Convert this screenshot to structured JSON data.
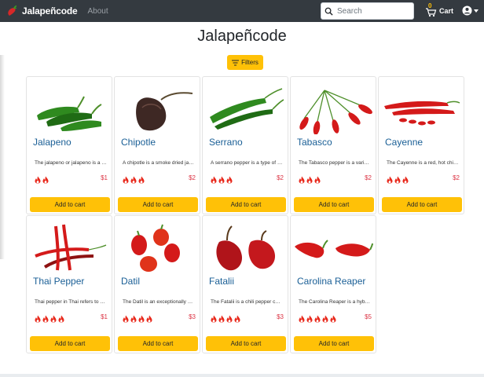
{
  "navbar": {
    "brand": "Jalapeñcode",
    "about": "About",
    "search_placeholder": "Search",
    "cart_count": "0",
    "cart_label": "Cart"
  },
  "page": {
    "title": "Jalapeñcode",
    "filters_label": "Filters"
  },
  "colors": {
    "navbar": "#343a40",
    "accent": "#ffc107",
    "link": "#1a5f96",
    "price": "#dc3545"
  },
  "products": [
    {
      "name": "Jalapeno",
      "description": "The jalapeno or jalapeno is a medium-sized chili pepper",
      "heat": 2,
      "price": "$1",
      "image": "jalapeno-photo",
      "button": "Add to cart"
    },
    {
      "name": "Chipotle",
      "description": "A chipotle is a smoke dried jalapeno",
      "heat": 3,
      "price": "$2",
      "image": "chipotle-photo",
      "button": "Add to cart"
    },
    {
      "name": "Serrano",
      "description": "A serrano pepper is a type of chili pepper",
      "heat": 3,
      "price": "$2",
      "image": "serrano-photo",
      "button": "Add to cart"
    },
    {
      "name": "Tabasco",
      "description": "The Tabasco pepper is a variety of chili pepper",
      "heat": 3,
      "price": "$2",
      "image": "tabasco-photo",
      "button": "Add to cart"
    },
    {
      "name": "Cayenne",
      "description": "The Cayenne is a red, hot chili pepper",
      "heat": 3,
      "price": "$2",
      "image": "cayenne-photo",
      "button": "Add to cart"
    },
    {
      "name": "Thai Pepper",
      "description": "Thai pepper in Thai refers to several chili peppers",
      "heat": 4,
      "price": "$1",
      "image": "thai-pepper-photo",
      "button": "Add to cart"
    },
    {
      "name": "Datil",
      "description": "The Datil is an exceptionally hot pepper",
      "heat": 4,
      "price": "$3",
      "image": "datil-photo",
      "button": "Add to cart"
    },
    {
      "name": "Fatalii",
      "description": "The Fatalii is a chili pepper cultivar",
      "heat": 4,
      "price": "$3",
      "image": "fatalii-photo",
      "button": "Add to cart"
    },
    {
      "name": "Carolina Reaper",
      "description": "The Carolina Reaper is a hybrid chili pepper",
      "heat": 5,
      "price": "$5",
      "image": "carolina-reaper-photo",
      "button": "Add to cart"
    }
  ]
}
